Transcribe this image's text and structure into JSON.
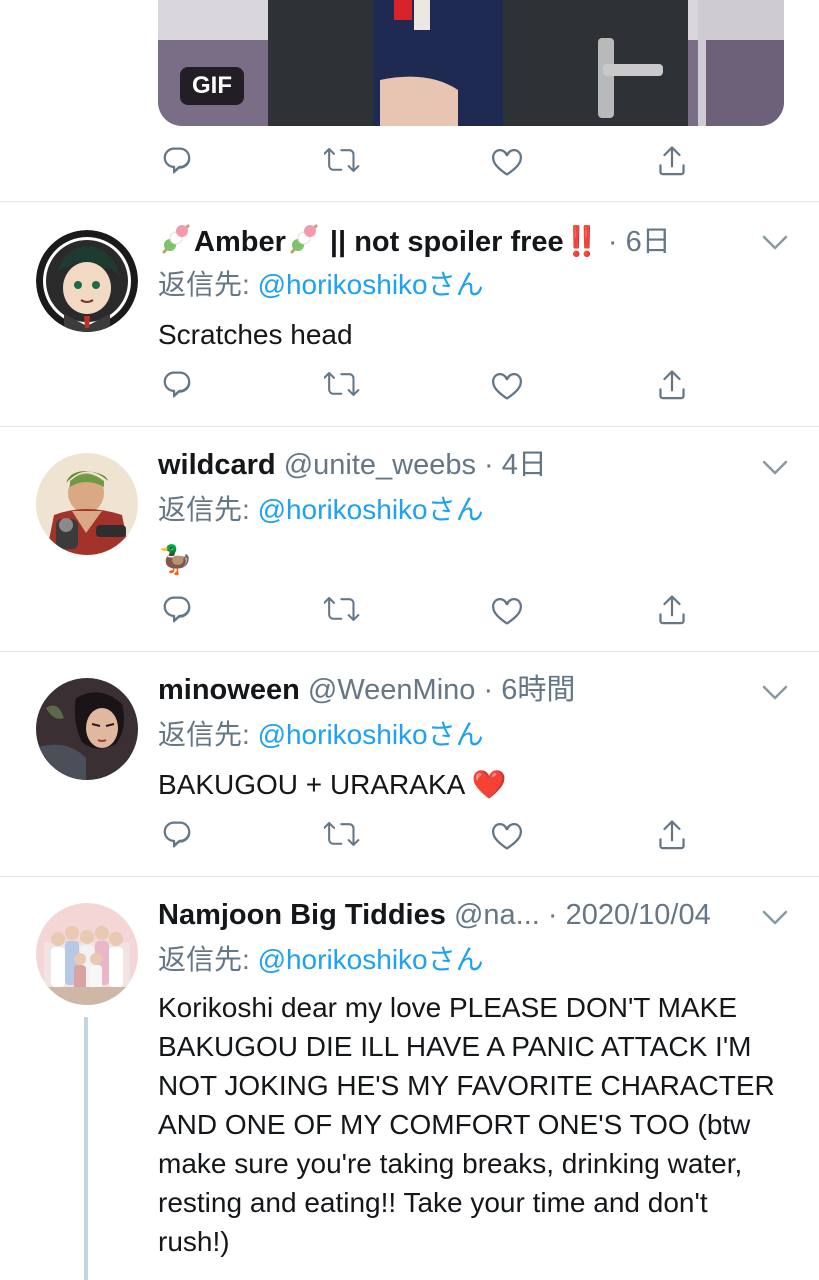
{
  "colors": {
    "accent": "#1da1f2",
    "muted": "#657786",
    "divider": "#e1e8ed"
  },
  "top_media": {
    "badge": "GIF"
  },
  "tweets": [
    {
      "name_prefix_icon": "dango-emoji",
      "name": "Amber",
      "name_rest": " || not spoiler free",
      "name_suffix": "‼️",
      "handle": "",
      "sep": " · ",
      "time": "6日",
      "reply_prefix": "返信先: ",
      "reply_to": "@horikoshikoさん",
      "text": "Scratches head"
    },
    {
      "name": "wildcard",
      "handle": "@unite_weebs",
      "sep": " · ",
      "time": "4日",
      "reply_prefix": "返信先: ",
      "reply_to": "@horikoshikoさん",
      "text": "🦆"
    },
    {
      "name": "minoween",
      "handle": "@WeenMino",
      "sep": " · ",
      "time": "6時間",
      "reply_prefix": "返信先: ",
      "reply_to": "@horikoshikoさん",
      "text": "BAKUGOU + URARAKA ❤️"
    },
    {
      "name": "Namjoon Big Tiddies",
      "handle": "@na...",
      "sep": " · ",
      "time": "2020/10/04",
      "reply_prefix": "返信先: ",
      "reply_to": "@horikoshikoさん",
      "text": "Korikoshi dear my love PLEASE DON'T MAKE BAKUGOU DIE ILL HAVE A PANIC ATTACK I'M NOT JOKING HE'S MY FAVORITE CHARACTER AND ONE OF MY COMFORT ONE'S TOO (btw make sure you're taking breaks, drinking water, resting and eating!! Take your time and don't rush!)"
    }
  ],
  "icons": [
    "reply-icon",
    "retweet-icon",
    "like-icon",
    "share-icon",
    "chevron-down-icon"
  ]
}
